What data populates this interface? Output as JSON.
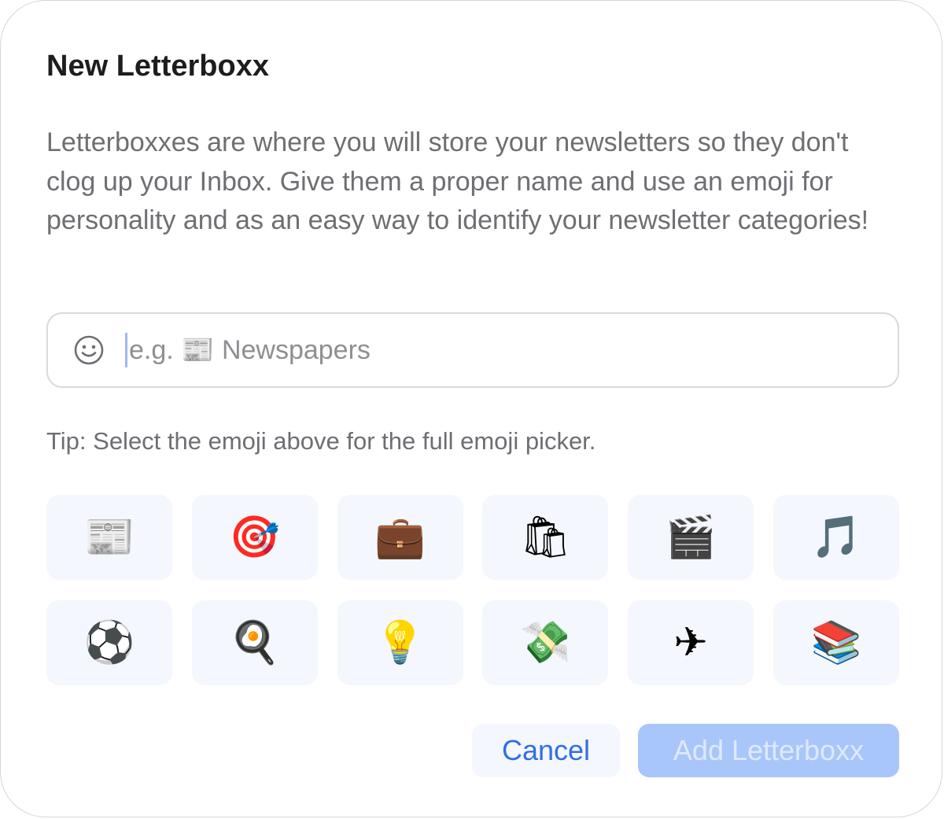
{
  "dialog": {
    "title": "New Letterboxx",
    "description": "Letterboxxes are where you will store your newsletters so they don't clog up your Inbox. Give them a proper name and use an emoji for personality and as an easy way to identify your newsletter categories!"
  },
  "name_field": {
    "value": "",
    "placeholder": "e.g. 📰 Newspapers",
    "emoji_button_icon": "smiley-face-icon"
  },
  "tip": "Tip: Select the emoji above for the full emoji picker.",
  "emoji_options": [
    {
      "emoji": "📰",
      "icon": "newspaper-emoji"
    },
    {
      "emoji": "🎯",
      "icon": "target-emoji"
    },
    {
      "emoji": "💼",
      "icon": "briefcase-emoji"
    },
    {
      "emoji": "🛍",
      "icon": "shopping-bags-emoji"
    },
    {
      "emoji": "🎬",
      "icon": "clapper-board-emoji"
    },
    {
      "emoji": "🎵",
      "icon": "musical-note-emoji"
    },
    {
      "emoji": "⚽",
      "icon": "soccer-ball-emoji"
    },
    {
      "emoji": "🍳",
      "icon": "frying-pan-egg-emoji"
    },
    {
      "emoji": "💡",
      "icon": "light-bulb-emoji"
    },
    {
      "emoji": "💸",
      "icon": "money-with-wings-emoji"
    },
    {
      "emoji": "✈",
      "icon": "airplane-emoji"
    },
    {
      "emoji": "📚",
      "icon": "books-emoji"
    }
  ],
  "actions": {
    "cancel_label": "Cancel",
    "add_label": "Add Letterboxx",
    "add_enabled": false
  },
  "colors": {
    "accent": "#2f6ee6",
    "button_disabled_bg": "#a9c6fa",
    "tile_bg": "#f4f7fd",
    "text_secondary": "#6e6e73",
    "text_primary": "#1d1d1f"
  }
}
